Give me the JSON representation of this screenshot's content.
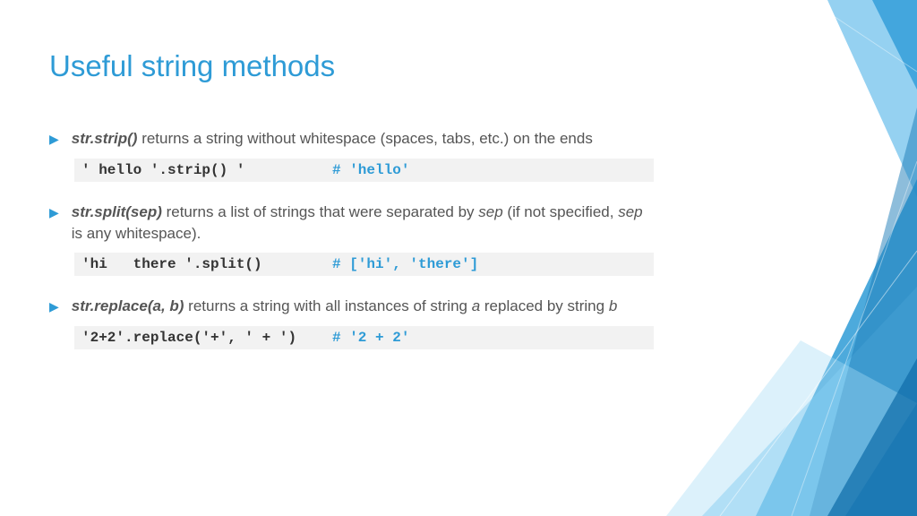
{
  "title": "Useful string methods",
  "items": [
    {
      "method": "str.strip()",
      "desc_tail": " returns a string without whitespace (spaces, tabs, etc.) on the ends",
      "code": "' hello '.strip() '",
      "comment": "# 'hello'"
    },
    {
      "method": "str.split(sep)",
      "desc_tail": " returns a list of strings that were separated by <i>sep</i> (if not specified, <i>sep</i> is any whitespace).",
      "code": "'hi   there '.split()",
      "comment": "# ['hi', 'there']"
    },
    {
      "method": "str.replace(a, b)",
      "desc_tail": " returns a string with all instances of string <i>a</i> replaced by string <i>b</i>",
      "code": "'2+2'.replace('+', ' + ')",
      "comment": "# '2 + 2'"
    }
  ]
}
